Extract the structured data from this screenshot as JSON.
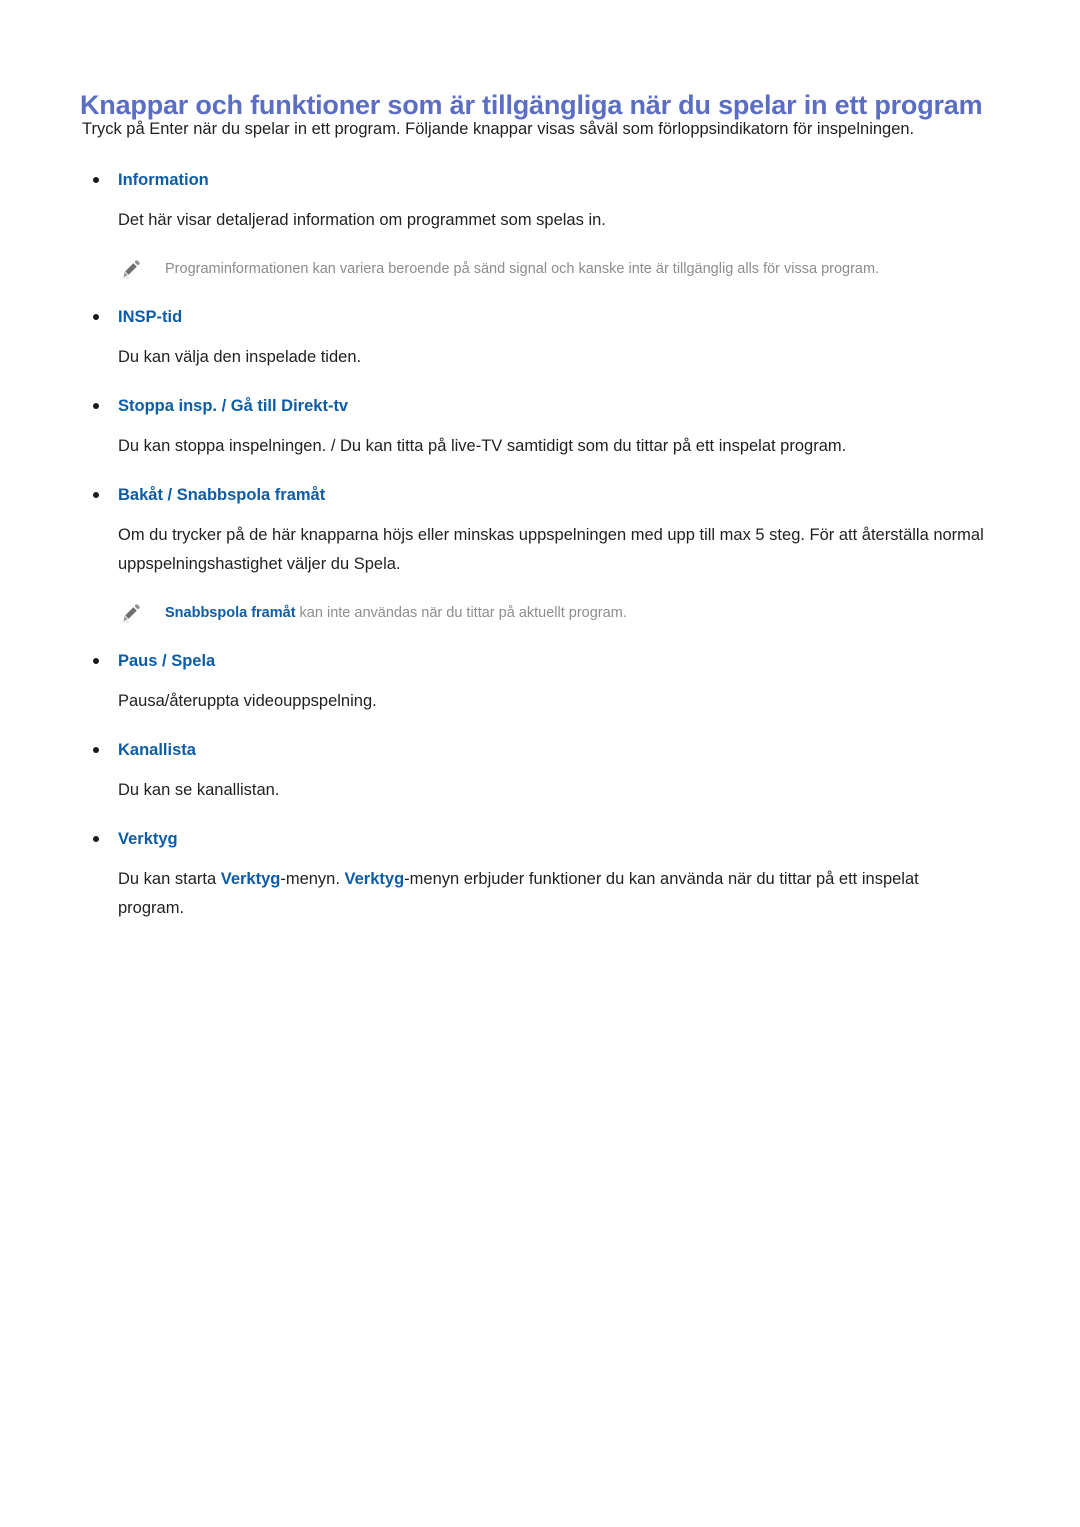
{
  "document": {
    "title": "Knappar och funktioner som är tillgängliga när du spelar in ett program",
    "intro": "Tryck på Enter när du spelar in ett program. Följande knappar visas såväl som förloppsindikatorn för inspelningen."
  },
  "colors": {
    "title": "#5b6ec4",
    "heading_blue": "#0d5ca5",
    "body_text": "#231f20",
    "note_text": "#8d8d8d",
    "bullet": "#1a1a1a",
    "page_background": "#ffffff"
  },
  "icons": {
    "bullet": "bullet-dot-icon",
    "note": "pencil-icon"
  },
  "sections": [
    {
      "heading": "Information",
      "body": "Det här visar detaljerad information om programmet som spelas in.",
      "note": {
        "strong": "",
        "text": "Programinformationen kan variera beroende på sänd signal och kanske inte är tillgänglig alls för vissa program."
      }
    },
    {
      "heading": "INSP-tid",
      "body": "Du kan välja den inspelade tiden.",
      "note": null
    },
    {
      "heading": "Stoppa insp. / Gå till Direkt-tv",
      "body": "Du kan stoppa inspelningen. / Du kan titta på live-TV samtidigt som du tittar på ett inspelat program.",
      "note": null
    },
    {
      "heading": "Bakåt / Snabbspola framåt",
      "body": "Om du trycker på de här knapparna höjs eller minskas uppspelningen med upp till max 5 steg. För att återställa normal uppspelningshastighet väljer du Spela.",
      "note": {
        "strong": "Snabbspola framåt",
        "text": " kan inte användas när du tittar på aktuellt program."
      }
    },
    {
      "heading": "Paus / Spela",
      "body": "Pausa/återuppta videouppspelning.",
      "note": null
    },
    {
      "heading": "Kanallista",
      "body": "Du kan se kanallistan.",
      "note": null
    },
    {
      "heading": "Verktyg",
      "body_parts": [
        {
          "text": "Du kan starta ",
          "highlight": false
        },
        {
          "text": "Verktyg",
          "highlight": true
        },
        {
          "text": "-menyn. ",
          "highlight": false
        },
        {
          "text": "Verktyg",
          "highlight": true
        },
        {
          "text": "-menyn erbjuder funktioner du kan använda när du tittar på ett inspelat program.",
          "highlight": false
        }
      ],
      "note": null
    }
  ]
}
